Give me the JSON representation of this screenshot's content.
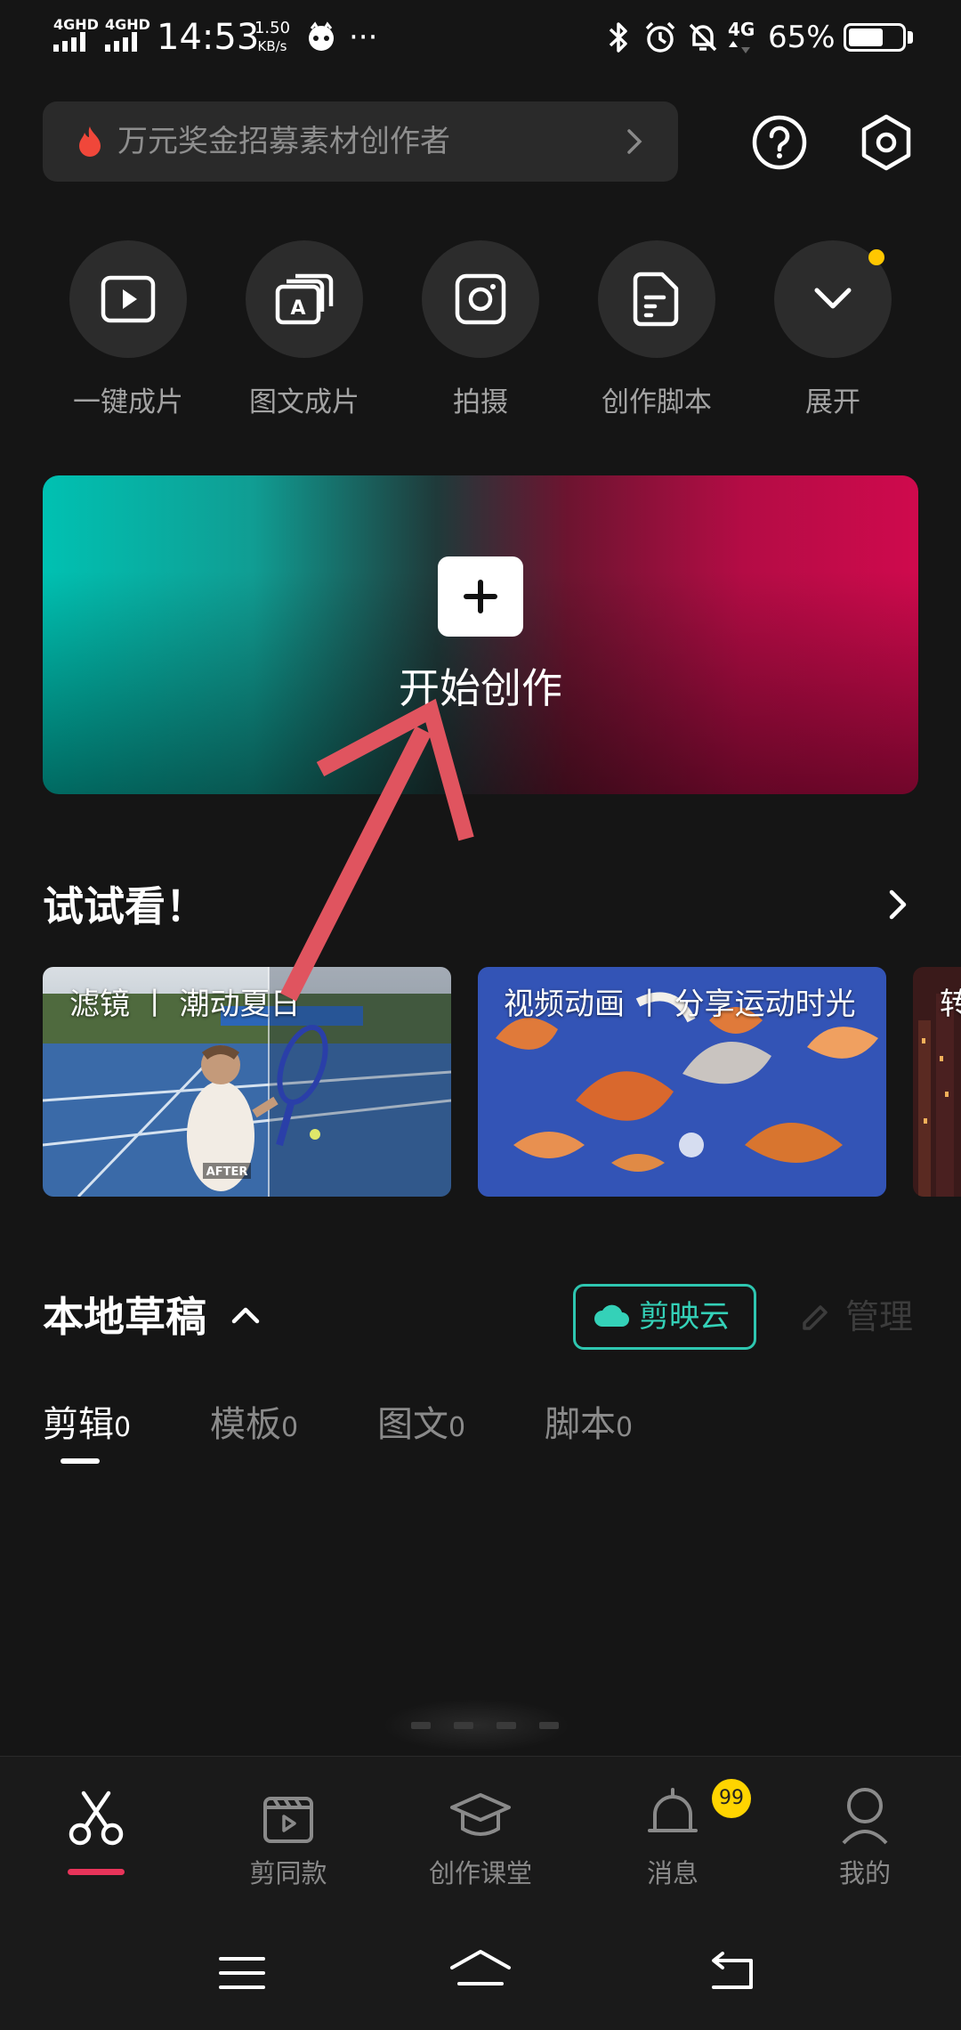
{
  "status_bar": {
    "net1": "4GHD",
    "net2": "4GHD",
    "time": "14:53",
    "speed_value": "1.50",
    "speed_unit": "KB/s",
    "more": "···",
    "net3": "4G",
    "battery_percent": "65%",
    "battery_level": 0.65
  },
  "search": {
    "text": "万元奖金招募素材创作者"
  },
  "quick_actions": [
    {
      "label": "一键成片",
      "icon": "play-video-icon"
    },
    {
      "label": "图文成片",
      "icon": "text-to-video-icon"
    },
    {
      "label": "拍摄",
      "icon": "camera-icon"
    },
    {
      "label": "创作脚本",
      "icon": "script-document-icon"
    },
    {
      "label": "展开",
      "icon": "chevron-down-icon"
    }
  ],
  "banner": {
    "title": "开始创作"
  },
  "try_section": {
    "title": "试试看！",
    "cards": [
      {
        "title": "滤镜 丨 潮动夏日",
        "tag": "AFTER"
      },
      {
        "title": "视频动画 丨 分享运动时光"
      },
      {
        "title": "转"
      }
    ]
  },
  "drafts": {
    "title": "本地草稿",
    "cloud_label": "剪映云",
    "manage_label": "管理",
    "tabs": [
      {
        "label": "剪辑",
        "count": "0"
      },
      {
        "label": "模板",
        "count": "0"
      },
      {
        "label": "图文",
        "count": "0"
      },
      {
        "label": "脚本",
        "count": "0"
      }
    ]
  },
  "bottom_nav": {
    "items": [
      {
        "label": "",
        "icon": "scissors-icon"
      },
      {
        "label": "剪同款",
        "icon": "template-video-icon"
      },
      {
        "label": "创作课堂",
        "icon": "graduation-cap-icon"
      },
      {
        "label": "消息",
        "icon": "bell-icon"
      },
      {
        "label": "我的",
        "icon": "person-icon"
      }
    ],
    "message_badge": "99"
  },
  "colors": {
    "background": "#151515",
    "accent_teal": "#34d1b8",
    "accent_red": "#e8345a",
    "badge_yellow": "#ffd400"
  }
}
